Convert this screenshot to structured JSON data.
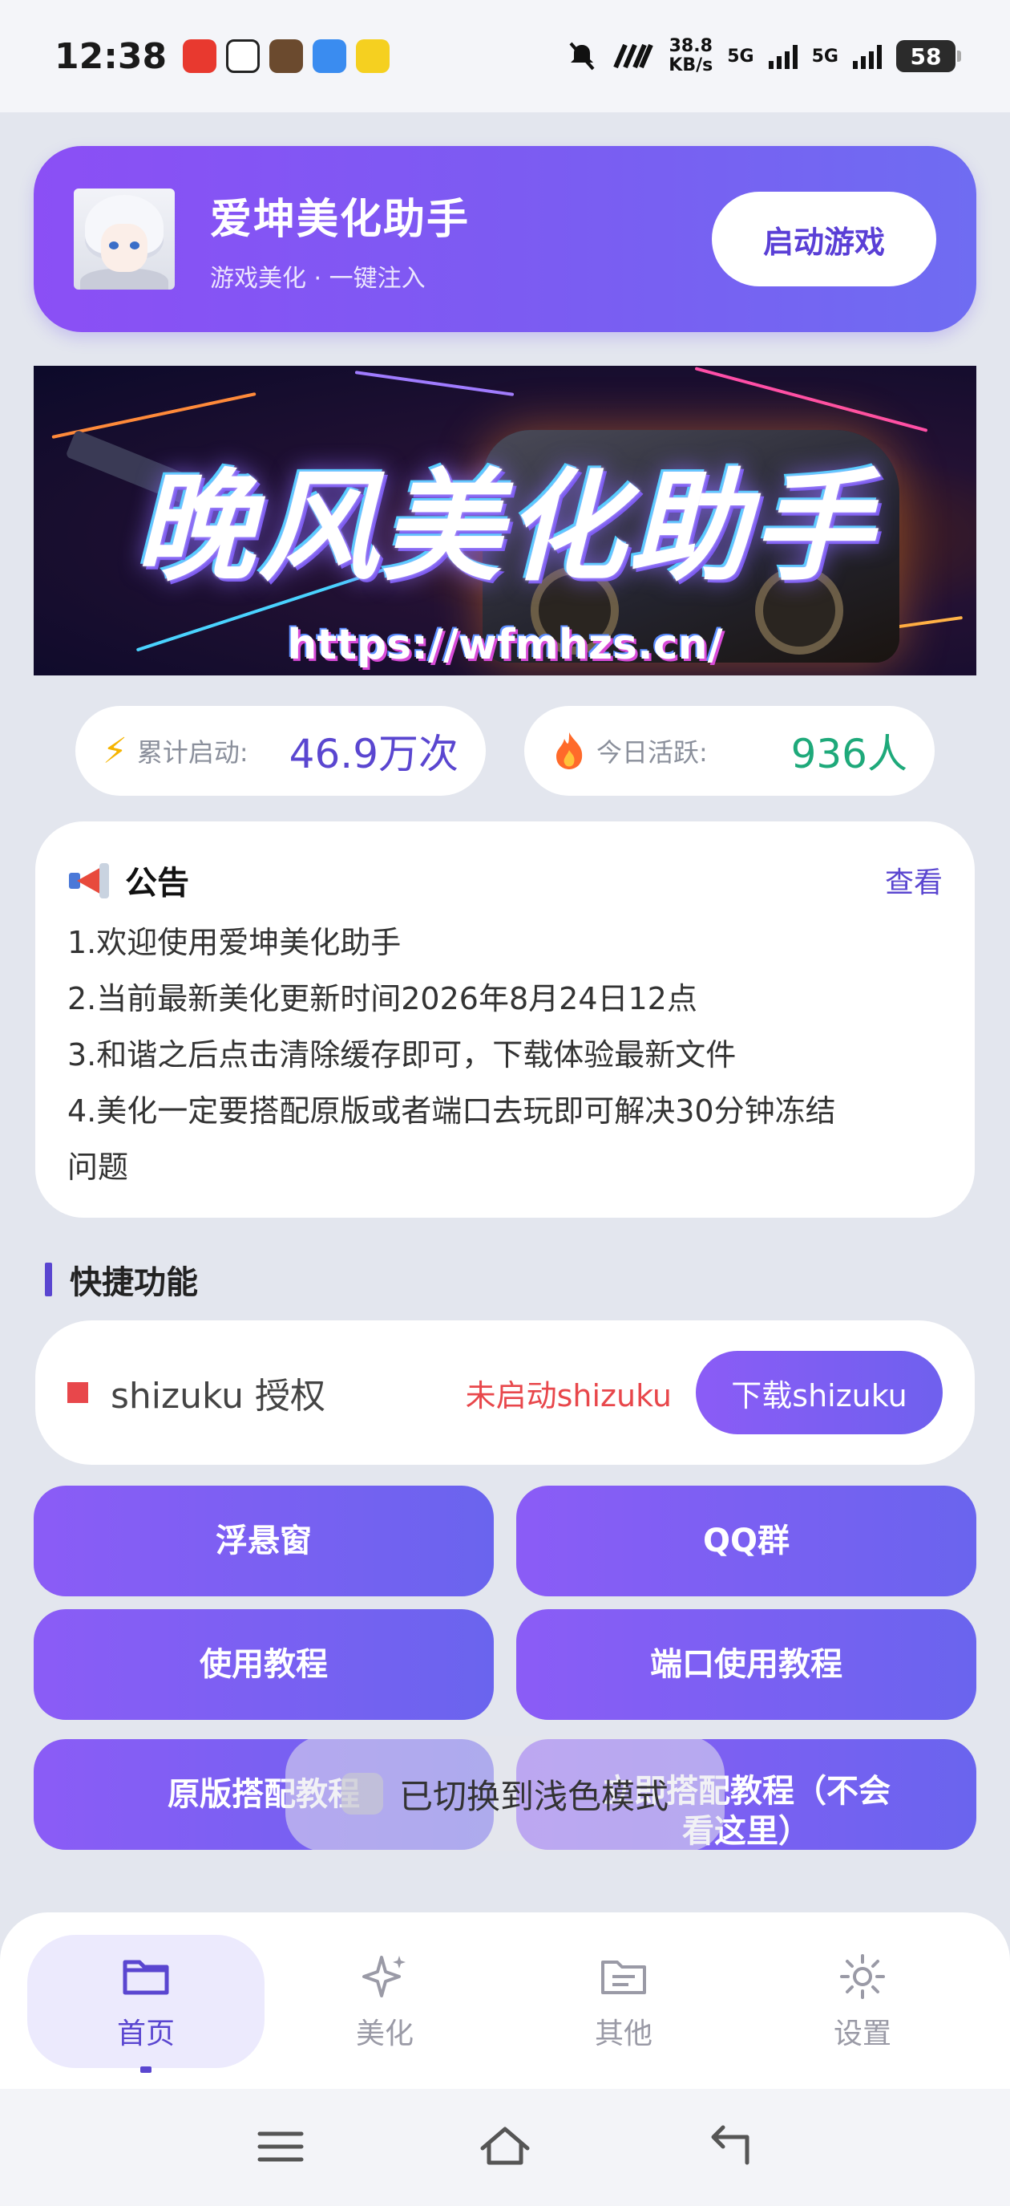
{
  "status_bar": {
    "time": "12:38",
    "net_speed_value": "38.8",
    "net_speed_unit": "KB/s",
    "signal1_label": "5G",
    "signal2_label": "5G",
    "battery": "58",
    "icons": [
      "app-notification-icon",
      "mute-icon",
      "hd-icon",
      "signal-icon",
      "battery-icon"
    ]
  },
  "header": {
    "title": "爱坤美化助手",
    "subtitle": "游戏美化 · 一键注入",
    "launch_button": "启动游戏"
  },
  "banner": {
    "title": "晚风美化助手",
    "url": "https://wfmhzs.cn/"
  },
  "stats": {
    "total_label": "累计启动:",
    "total_value": "46.9万次",
    "active_label": "今日活跃:",
    "active_value": "936人"
  },
  "notice": {
    "title": "公告",
    "view_link": "查看",
    "lines": [
      "1.欢迎使用爱坤美化助手",
      "2.当前最新美化更新时间2026年8月24日12点",
      "3.和谐之后点击清除缓存即可，下载体验最新文件",
      "4.美化一定要搭配原版或者端口去玩即可解决30分钟冻结",
      "问题"
    ]
  },
  "quick": {
    "section_title": "快捷功能",
    "shizuku_label": "shizuku 授权",
    "shizuku_status": "未启动shizuku",
    "shizuku_button": "下载shizuku",
    "buttons": [
      "浮悬窗",
      "QQ群",
      "使用教程",
      "端口使用教程",
      "原版搭配教程",
      "立即搭配教程（不会",
      "看这里）"
    ]
  },
  "toast": {
    "text": "已切换到浅色模式"
  },
  "nav": {
    "items": [
      {
        "label": "首页",
        "icon": "folder-icon"
      },
      {
        "label": "美化",
        "icon": "sparkle-icon"
      },
      {
        "label": "其他",
        "icon": "folder-doc-icon"
      },
      {
        "label": "设置",
        "icon": "sun-gear-icon"
      }
    ],
    "active_index": 0
  },
  "colors": {
    "accent": "#5a46d0",
    "gradient_start": "#8b5cf6",
    "gradient_end": "#6a64ee",
    "success": "#1ea97a",
    "error": "#e8474b"
  }
}
